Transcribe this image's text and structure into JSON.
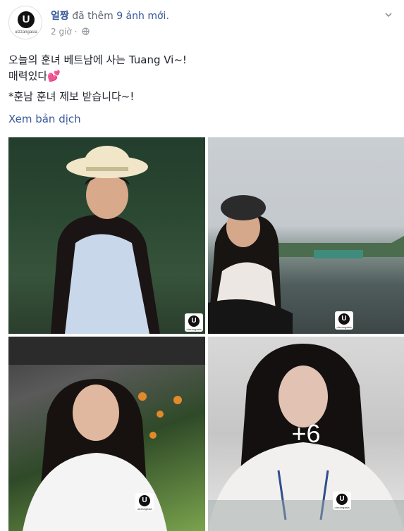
{
  "post": {
    "author": "얼짱",
    "action": "đã thêm",
    "photos_added": "9 ảnh mới",
    "period": ".",
    "time": "2 giờ",
    "separator": "·",
    "privacy_icon": "globe-icon",
    "text_lines": [
      "오늘의 훈녀 베트남에 사는 Tuang Vi~!",
      "매력있다💕",
      "*훈남 훈녀 제보 받습니다~!"
    ],
    "translate_link": "Xem bản dịch"
  },
  "avatar": {
    "letter": "U",
    "brand": "ulzzangasia"
  },
  "photos": [
    {
      "watermark_letter": "U",
      "watermark_brand": "ulzzangasia"
    },
    {
      "watermark_letter": "U",
      "watermark_brand": "ulzzangasia"
    },
    {
      "watermark_letter": "U",
      "watermark_brand": "ulzzangasia"
    },
    {
      "watermark_letter": "U",
      "watermark_brand": "ulzzangasia",
      "more_count": "+6"
    }
  ],
  "colors": {
    "link": "#365899",
    "muted": "#90949c",
    "text": "#1d2129"
  }
}
